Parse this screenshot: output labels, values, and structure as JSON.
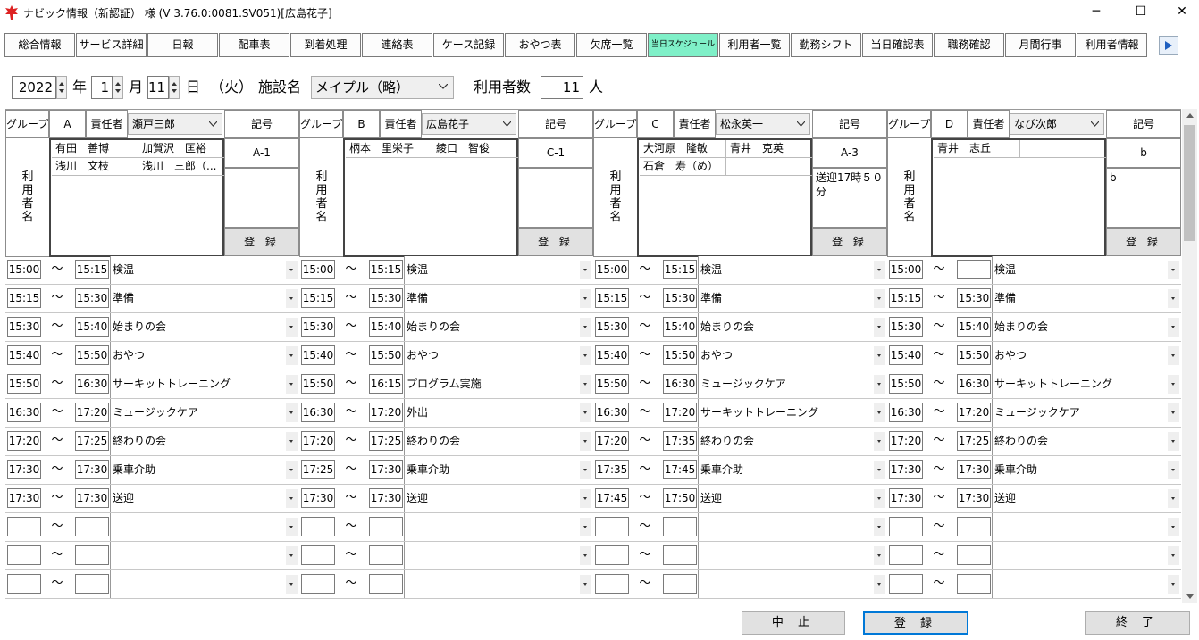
{
  "window": {
    "title": "ナビック情報（新認証） 様 (V 3.76.0:0081.SV051)[広島花子]",
    "minimize": "─",
    "maximize": "☐",
    "close": "✕"
  },
  "tabs": [
    "総合情報",
    "サービス詳細",
    "日報",
    "配車表",
    "到着処理",
    "連絡表",
    "ケース記録",
    "おやつ表",
    "欠席一覧",
    "当日スケジュール",
    "利用者一覧",
    "勤務シフト",
    "当日確認表",
    "職務確認",
    "月間行事",
    "利用者情報"
  ],
  "active_tab": "当日スケジュール",
  "datebar": {
    "year": "2022",
    "year_unit": "年",
    "month": "1",
    "month_unit": "月",
    "day": "11",
    "day_unit": "日",
    "weekday": "（火）",
    "facility_label": "施設名",
    "facility": "メイプル（略）",
    "users_label": "利用者数",
    "users_count": "11",
    "users_unit": "人"
  },
  "labels": {
    "group": "グループ",
    "manager": "責任者",
    "code": "記号",
    "members": "利用者名",
    "register": "登 録",
    "tilde": "～"
  },
  "groups": [
    {
      "name": "A",
      "manager": "瀬戸三郎",
      "code": "A-1",
      "memo": "",
      "members": [
        "有田　善博",
        "加賀沢　匡裕",
        "浅川　文枝",
        "浅川　三郎（..."
      ],
      "rows": [
        [
          "15:00",
          "15:15",
          "検温"
        ],
        [
          "15:15",
          "15:30",
          "準備"
        ],
        [
          "15:30",
          "15:40",
          "始まりの会"
        ],
        [
          "15:40",
          "15:50",
          "おやつ"
        ],
        [
          "15:50",
          "16:30",
          "サーキットトレーニング"
        ],
        [
          "16:30",
          "17:20",
          "ミュージックケア"
        ],
        [
          "17:20",
          "17:25",
          "終わりの会"
        ],
        [
          "17:30",
          "17:30",
          "乗車介助"
        ],
        [
          "17:30",
          "17:30",
          "送迎"
        ],
        [
          "",
          "",
          ""
        ],
        [
          "",
          "",
          ""
        ],
        [
          "",
          "",
          ""
        ]
      ]
    },
    {
      "name": "B",
      "manager": "広島花子",
      "code": "C-1",
      "memo": "",
      "members": [
        "柄本　里栄子",
        "綾口　智俊"
      ],
      "rows": [
        [
          "15:00",
          "15:15",
          "検温"
        ],
        [
          "15:15",
          "15:30",
          "準備"
        ],
        [
          "15:30",
          "15:40",
          "始まりの会"
        ],
        [
          "15:40",
          "15:50",
          "おやつ"
        ],
        [
          "15:50",
          "16:15",
          "プログラム実施"
        ],
        [
          "16:30",
          "17:20",
          "外出"
        ],
        [
          "17:20",
          "17:25",
          "終わりの会"
        ],
        [
          "17:25",
          "17:30",
          "乗車介助"
        ],
        [
          "17:30",
          "17:30",
          "送迎"
        ],
        [
          "",
          "",
          ""
        ],
        [
          "",
          "",
          ""
        ],
        [
          "",
          "",
          ""
        ]
      ]
    },
    {
      "name": "C",
      "manager": "松永英一",
      "code": "A-3",
      "memo": "送迎17時５０分",
      "members": [
        "大河原　隆敏",
        "青井　克英",
        "石倉　寿（め）",
        ""
      ],
      "rows": [
        [
          "15:00",
          "15:15",
          "検温"
        ],
        [
          "15:15",
          "15:30",
          "準備"
        ],
        [
          "15:30",
          "15:40",
          "始まりの会"
        ],
        [
          "15:40",
          "15:50",
          "おやつ"
        ],
        [
          "15:50",
          "16:30",
          "ミュージックケア"
        ],
        [
          "16:30",
          "17:20",
          "サーキットトレーニング"
        ],
        [
          "17:20",
          "17:35",
          "終わりの会"
        ],
        [
          "17:35",
          "17:45",
          "乗車介助"
        ],
        [
          "17:45",
          "17:50",
          "送迎"
        ],
        [
          "",
          "",
          ""
        ],
        [
          "",
          "",
          ""
        ],
        [
          "",
          "",
          ""
        ]
      ]
    },
    {
      "name": "D",
      "manager": "なび次郎",
      "code": "b",
      "memo": "b",
      "members": [
        "青井　志丘",
        ""
      ],
      "rows": [
        [
          "15:00",
          "",
          "検温"
        ],
        [
          "15:15",
          "15:30",
          "準備"
        ],
        [
          "15:30",
          "15:40",
          "始まりの会"
        ],
        [
          "15:40",
          "15:50",
          "おやつ"
        ],
        [
          "15:50",
          "16:30",
          "サーキットトレーニング"
        ],
        [
          "16:30",
          "17:20",
          "ミュージックケア"
        ],
        [
          "17:20",
          "17:25",
          "終わりの会"
        ],
        [
          "17:30",
          "17:30",
          "乗車介助"
        ],
        [
          "17:30",
          "17:30",
          "送迎"
        ],
        [
          "",
          "",
          ""
        ],
        [
          "",
          "",
          ""
        ],
        [
          "",
          "",
          ""
        ]
      ]
    }
  ],
  "footer": {
    "cancel": "中 止",
    "register": "登 録",
    "exit": "終 了"
  }
}
